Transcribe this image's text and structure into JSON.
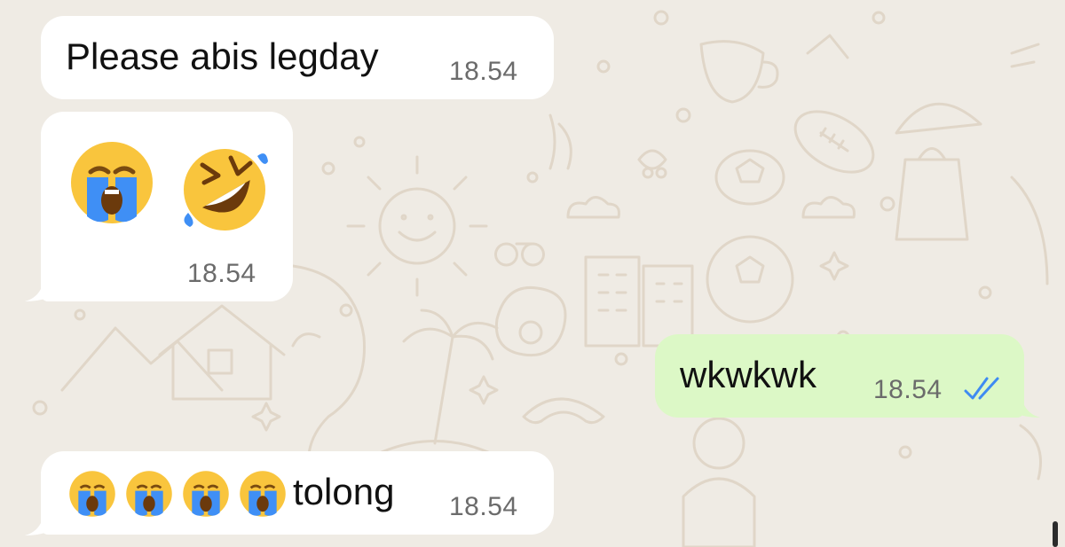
{
  "messages": [
    {
      "direction": "incoming",
      "text": "Please abis legday",
      "time": "18.54"
    },
    {
      "direction": "incoming",
      "emojis": [
        "loudly-crying-face",
        "rolling-on-floor-laughing-face"
      ],
      "time": "18.54"
    },
    {
      "direction": "outgoing",
      "text": "wkwkwk",
      "time": "18.54",
      "status": "read",
      "status_color": "#3e8bf2"
    },
    {
      "direction": "incoming",
      "emojis": [
        "loudly-crying-face",
        "loudly-crying-face",
        "loudly-crying-face",
        "loudly-crying-face"
      ],
      "text": "tolong",
      "time": "18.54"
    }
  ],
  "colors": {
    "incoming_bubble": "#ffffff",
    "outgoing_bubble": "#dcf8c6",
    "wallpaper": "#efebe4",
    "doodle": "#e2d8cb",
    "read_ticks": "#3e8bf2"
  }
}
